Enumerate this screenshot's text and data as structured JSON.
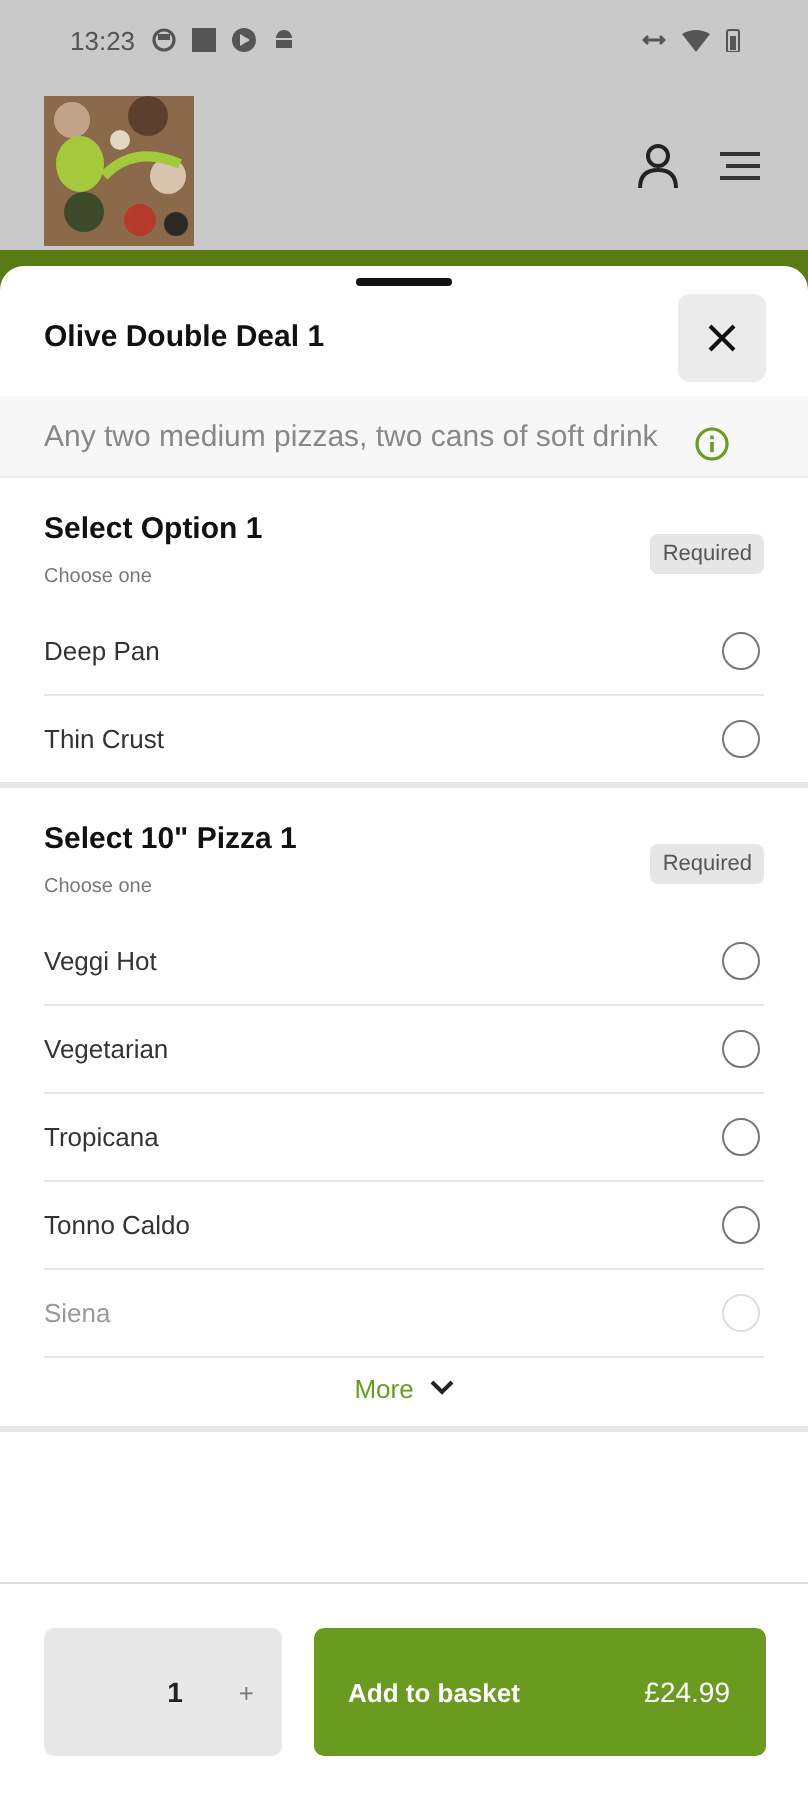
{
  "status_bar": {
    "time": "13:23"
  },
  "sheet": {
    "title": "Olive Double Deal 1",
    "description": "Any two medium pizzas, two cans of soft drink",
    "groups": [
      {
        "title": "Select Option 1",
        "hint": "Choose one",
        "badge": "Required",
        "options": [
          {
            "label": "Deep Pan",
            "selected": false,
            "faded": false
          },
          {
            "label": "Thin Crust",
            "selected": false,
            "faded": false
          }
        ]
      },
      {
        "title": "Select 10\" Pizza 1",
        "hint": "Choose one",
        "badge": "Required",
        "more": "More",
        "options": [
          {
            "label": "Veggi Hot",
            "selected": false,
            "faded": false
          },
          {
            "label": "Vegetarian",
            "selected": false,
            "faded": false
          },
          {
            "label": "Tropicana",
            "selected": false,
            "faded": false
          },
          {
            "label": "Tonno Caldo",
            "selected": false,
            "faded": false
          },
          {
            "label": "Siena",
            "selected": false,
            "faded": true
          }
        ]
      }
    ]
  },
  "footer": {
    "quantity": "1",
    "plus": "+",
    "add_label": "Add to basket",
    "price": "£24.99"
  }
}
